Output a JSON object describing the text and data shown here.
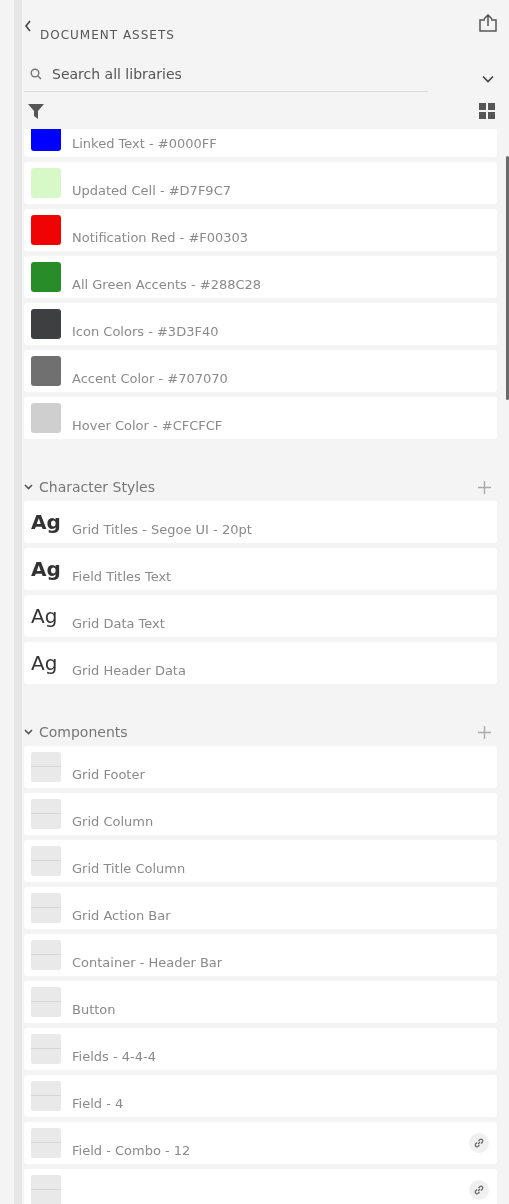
{
  "header": {
    "title": "DOCUMENT ASSETS"
  },
  "search": {
    "placeholder": "Search all libraries"
  },
  "colors": [
    {
      "name": "Linked Text - #0000FF",
      "color": "#0000ff"
    },
    {
      "name": "Updated Cell - #D7F9C7",
      "color": "#d7f9c7"
    },
    {
      "name": "Notification Red - #F00303",
      "color": "#f00303"
    },
    {
      "name": "All Green Accents - #288C28",
      "color": "#288c28"
    },
    {
      "name": "Icon Colors - #3D3F40",
      "color": "#3d3f40"
    },
    {
      "name": "Accent Color - #707070",
      "color": "#707070"
    },
    {
      "name": "Hover Color - #CFCFCF",
      "color": "#cfcfcf"
    }
  ],
  "character_styles": {
    "title": "Character Styles",
    "expanded": true,
    "items": [
      {
        "sample": "Ag",
        "bold": true,
        "name": "Grid Titles - Segoe UI - 20pt"
      },
      {
        "sample": "Ag",
        "bold": true,
        "name": "Field Titles Text"
      },
      {
        "sample": "Ag",
        "bold": false,
        "name": "Grid Data Text"
      },
      {
        "sample": "Ag",
        "bold": false,
        "name": "Grid Header Data"
      }
    ]
  },
  "components": {
    "title": "Components",
    "expanded": true,
    "items": [
      {
        "name": "Grid Footer",
        "linked": false
      },
      {
        "name": "Grid Column",
        "linked": false
      },
      {
        "name": "Grid Title Column",
        "linked": false
      },
      {
        "name": "Grid Action Bar",
        "linked": false
      },
      {
        "name": "Container - Header Bar",
        "linked": false
      },
      {
        "name": "Button",
        "linked": false
      },
      {
        "name": "Fields - 4-4-4",
        "linked": false
      },
      {
        "name": "Field - 4",
        "linked": false
      },
      {
        "name": "Field - Combo - 12",
        "linked": true
      },
      {
        "linked": true
      }
    ]
  }
}
